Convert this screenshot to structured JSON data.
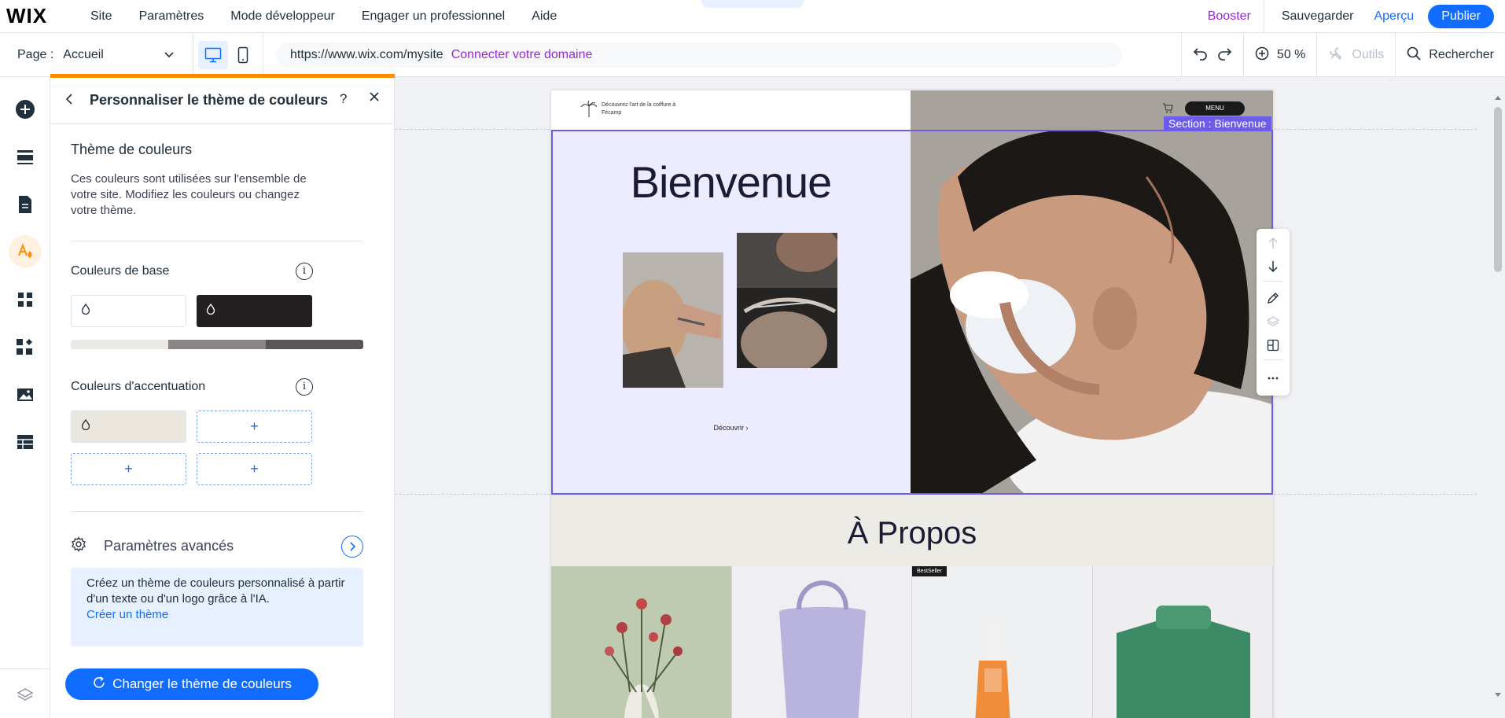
{
  "topbar": {
    "logo": "WIX",
    "menu": [
      "Site",
      "Paramètres",
      "Mode développeur",
      "Engager un professionnel",
      "Aide"
    ],
    "booster": "Booster",
    "save": "Sauvegarder",
    "preview": "Aperçu",
    "publish": "Publier"
  },
  "secbar": {
    "page_label": "Page :",
    "page_value": "Accueil",
    "url": "https://www.wix.com/mysite",
    "connect_domain": "Connecter votre domaine",
    "zoom": "50 %",
    "tools": "Outils",
    "search": "Rechercher"
  },
  "panel": {
    "title": "Personnaliser le thème de couleurs",
    "help": "?",
    "section_title": "Thème de couleurs",
    "description": "Ces couleurs sont utilisées sur l'ensemble de votre site. Modifiez les couleurs ou changez votre thème.",
    "base_colors_label": "Couleurs de base",
    "accent_colors_label": "Couleurs d'accentuation",
    "info_glyph": "i",
    "add_glyph": "+",
    "advanced_settings": "Paramètres avancés",
    "ai_text": "Créez un thème de couleurs personnalisé à partir d'un texte ou d'un logo grâce à l'IA.",
    "ai_link": "Créer un thème",
    "change_button": "Changer le thème de couleurs",
    "colors": {
      "base_light": "#ffffff",
      "base_dark": "#231f20",
      "accent_1": "#ece7de",
      "gradient": [
        "#ebe9e6",
        "#8b8686",
        "#5a5657"
      ]
    }
  },
  "site": {
    "tagline": "Découvrez l'art de la coiffure à Fécamp",
    "menu": "MENU",
    "section_label": "Section : Bienvenue",
    "welcome": "Bienvenue",
    "discover": "Découvrir ›",
    "about": "À Propos",
    "badge": "BestSeller"
  },
  "colors": {
    "accent": "#116dff",
    "booster": "#9a27d5",
    "selection": "#6c5ce7",
    "panel_highlight": "#ff8b00"
  }
}
